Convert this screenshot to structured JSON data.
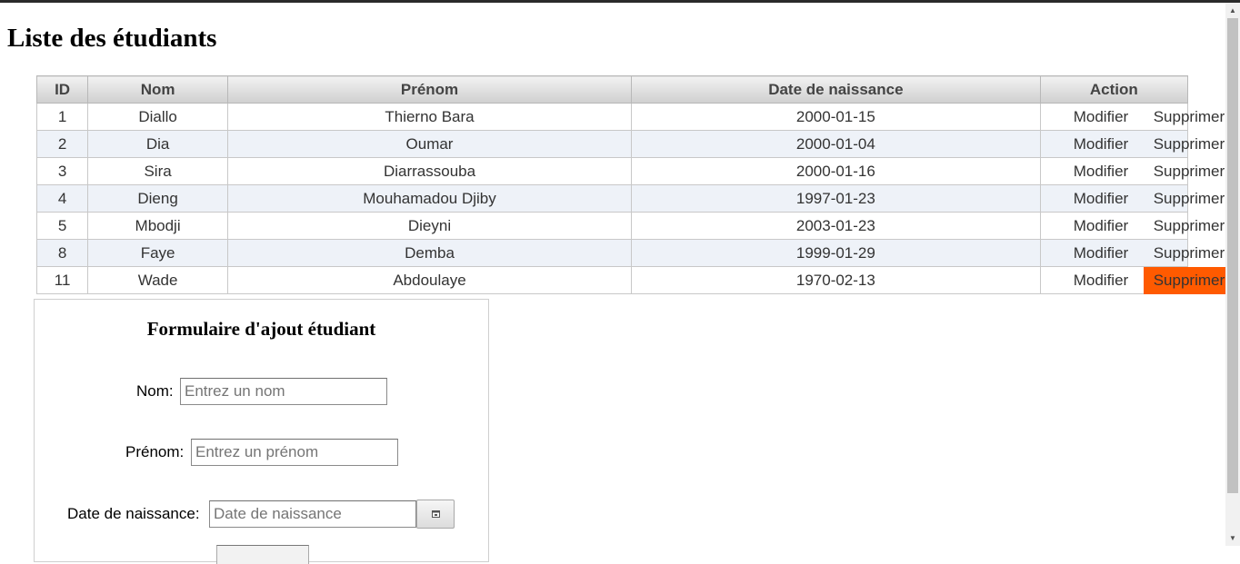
{
  "page": {
    "title": "Liste des étudiants"
  },
  "table": {
    "headers": [
      "ID",
      "Nom",
      "Prénom",
      "Date de naissance",
      "Action"
    ],
    "rows": [
      {
        "id": "1",
        "nom": "Diallo",
        "prenom": "Thierno Bara",
        "date": "2000-01-15"
      },
      {
        "id": "2",
        "nom": "Dia",
        "prenom": "Oumar",
        "date": "2000-01-04"
      },
      {
        "id": "3",
        "nom": "Sira",
        "prenom": "Diarrassouba",
        "date": "2000-01-16"
      },
      {
        "id": "4",
        "nom": "Dieng",
        "prenom": "Mouhamadou Djiby",
        "date": "1997-01-23"
      },
      {
        "id": "5",
        "nom": "Mbodji",
        "prenom": "Dieyni",
        "date": "2003-01-23"
      },
      {
        "id": "8",
        "nom": "Faye",
        "prenom": "Demba",
        "date": "1999-01-29"
      },
      {
        "id": "11",
        "nom": "Wade",
        "prenom": "Abdoulaye",
        "date": "1970-02-13"
      }
    ],
    "actions": {
      "edit_label": "Modifier",
      "delete_label": "Supprimer"
    },
    "highlight_color": "#ff5a00",
    "striped_row_color": "#eef2f8"
  },
  "form": {
    "title": "Formulaire d'ajout étudiant",
    "nom": {
      "label": "Nom:",
      "placeholder": "Entrez un nom"
    },
    "prenom": {
      "label": "Prénom:",
      "placeholder": "Entrez un prénom"
    },
    "date": {
      "label": "Date de naissance:",
      "placeholder": "Date de naissance",
      "picker_icon": "calendar-icon"
    }
  }
}
